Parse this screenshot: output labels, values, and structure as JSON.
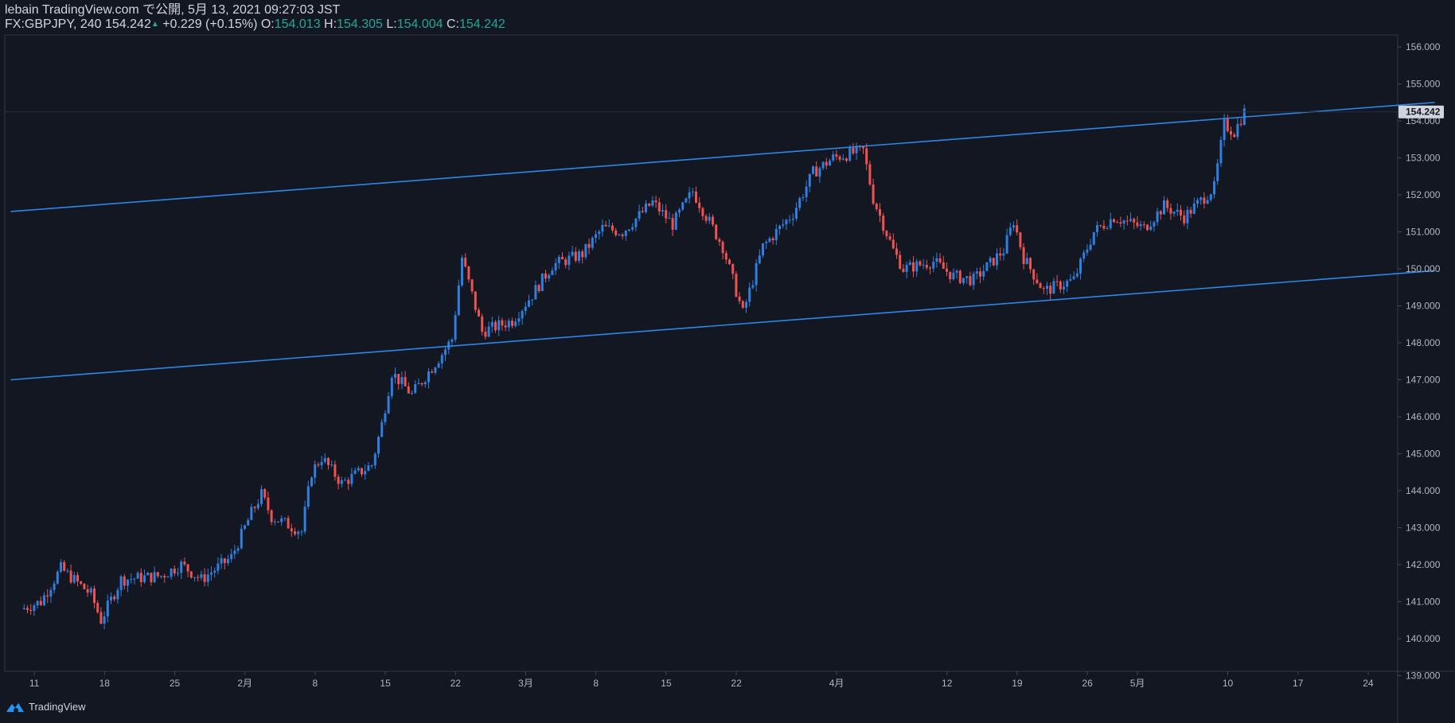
{
  "header": {
    "publish_line": "lebain TradingView.com で公開, 5月 13, 2021 09:27:03 JST",
    "symbol": "FX:GBPJPY, 240",
    "last": "154.242",
    "change": "+0.229 (+0.15%)",
    "o_label": "O:",
    "o_value": "154.013",
    "h_label": "H:",
    "h_value": "154.305",
    "l_label": "L:",
    "l_value": "154.004",
    "c_label": "C:",
    "c_value": "154.242"
  },
  "footer": {
    "brand": "TradingView"
  },
  "colors": {
    "background": "#131722",
    "up": "#2f7fe0",
    "down": "#ef5350",
    "line": "#2f86e6",
    "text": "#b2b5be"
  },
  "chart_data": {
    "type": "candlestick",
    "title": "",
    "ylim": [
      139.0,
      156.0
    ],
    "y_ticks": [
      "156.000",
      "155.000",
      "154.000",
      "153.000",
      "152.000",
      "151.000",
      "150.000",
      "149.000",
      "148.000",
      "147.000",
      "146.000",
      "145.000",
      "144.000",
      "143.000",
      "142.000",
      "141.000",
      "140.000",
      "139.000"
    ],
    "x_ticks": [
      "11",
      "18",
      "25",
      "2月",
      "8",
      "15",
      "22",
      "3月",
      "8",
      "15",
      "22",
      "4月",
      "12",
      "19",
      "26",
      "5月",
      "10",
      "17",
      "24"
    ],
    "current_price_label": "154.242",
    "trendlines": [
      {
        "name": "",
        "from": [
          "Jan 10",
          151.55
        ],
        "to": [
          "Jun 1",
          154.5
        ]
      },
      {
        "name": "",
        "from": [
          "Jan 10",
          147.0
        ],
        "to": [
          "Jun 1",
          149.95
        ]
      }
    ],
    "approx_close_path": [
      [
        "Jan 11",
        140.8
      ],
      [
        "Jan 13",
        141.0
      ],
      [
        "Jan 15",
        141.9
      ],
      [
        "Jan 18",
        141.2
      ],
      [
        "Jan 19",
        140.5
      ],
      [
        "Jan 21",
        141.6
      ],
      [
        "Jan 25",
        141.7
      ],
      [
        "Jan 27",
        142.0
      ],
      [
        "Jan 29",
        141.6
      ],
      [
        "Feb 1",
        142.2
      ],
      [
        "Feb 3",
        143.4
      ],
      [
        "Feb 4",
        143.9
      ],
      [
        "Feb 5",
        143.3
      ],
      [
        "Feb 8",
        142.9
      ],
      [
        "Feb 9",
        144.5
      ],
      [
        "Feb 10",
        144.9
      ],
      [
        "Feb 12",
        144.2
      ],
      [
        "Feb 15",
        144.7
      ],
      [
        "Feb 16",
        145.8
      ],
      [
        "Feb 17",
        147.2
      ],
      [
        "Feb 19",
        146.6
      ],
      [
        "Feb 22",
        147.7
      ],
      [
        "Feb 23",
        148.1
      ],
      [
        "Feb 24",
        150.3
      ],
      [
        "Feb 26",
        148.3
      ],
      [
        "Mar 1",
        148.6
      ],
      [
        "Mar 3",
        149.3
      ],
      [
        "Mar 5",
        150.1
      ],
      [
        "Mar 8",
        150.4
      ],
      [
        "Mar 10",
        151.1
      ],
      [
        "Mar 12",
        151.0
      ],
      [
        "Mar 15",
        151.8
      ],
      [
        "Mar 17",
        151.2
      ],
      [
        "Mar 19",
        152.1
      ],
      [
        "Mar 22",
        150.6
      ],
      [
        "Mar 24",
        148.8
      ],
      [
        "Mar 26",
        150.6
      ],
      [
        "Mar 29",
        151.5
      ],
      [
        "Mar 31",
        152.6
      ],
      [
        "Apr 2",
        153.0
      ],
      [
        "Apr 5",
        153.2
      ],
      [
        "Apr 6",
        151.9
      ],
      [
        "Apr 8",
        150.5
      ],
      [
        "Apr 9",
        150.0
      ],
      [
        "Apr 12",
        150.2
      ],
      [
        "Apr 14",
        149.8
      ],
      [
        "Apr 16",
        149.7
      ],
      [
        "Apr 19",
        150.5
      ],
      [
        "Apr 20",
        151.3
      ],
      [
        "Apr 21",
        150.3
      ],
      [
        "Apr 23",
        149.4
      ],
      [
        "Apr 26",
        149.7
      ],
      [
        "Apr 28",
        151.0
      ],
      [
        "Apr 30",
        151.4
      ],
      [
        "May 3",
        151.1
      ],
      [
        "May 5",
        151.7
      ],
      [
        "May 7",
        151.4
      ],
      [
        "May 10",
        152.2
      ],
      [
        "May 11",
        153.9
      ],
      [
        "May 12",
        153.7
      ],
      [
        "May 13",
        154.242
      ]
    ]
  }
}
